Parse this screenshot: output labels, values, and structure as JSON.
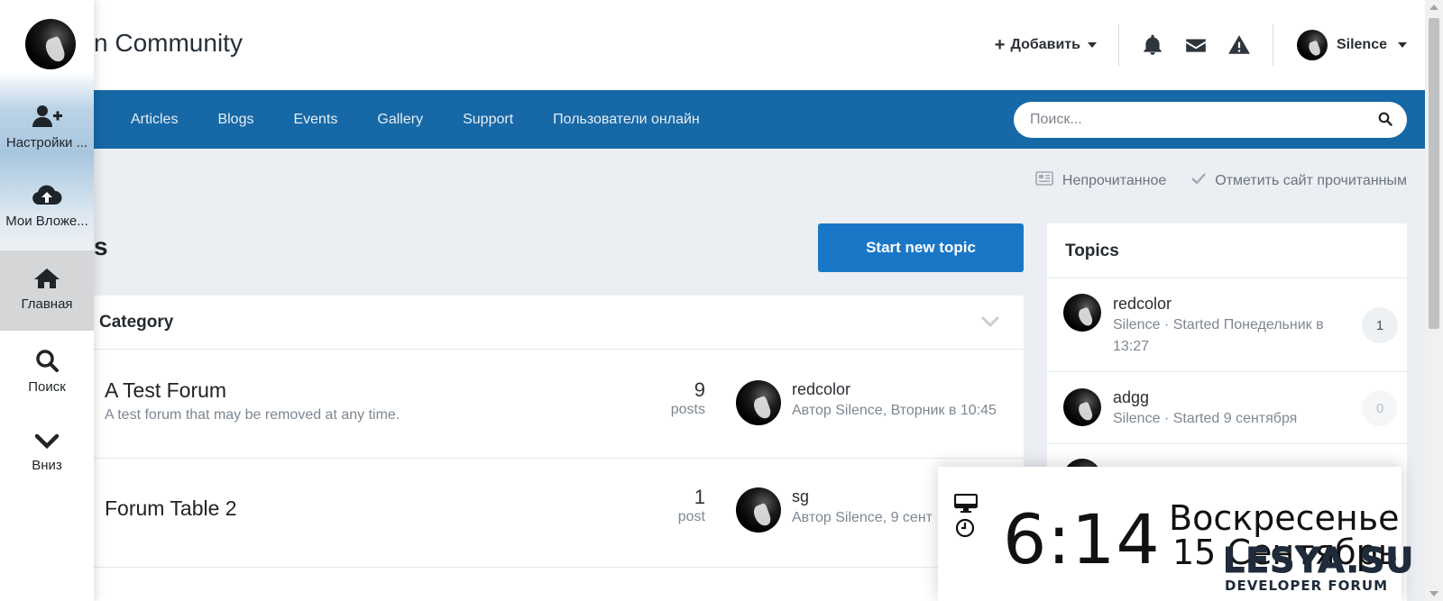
{
  "header": {
    "site_title": "n Community",
    "add_label": "Добавить",
    "user_name": "Silence"
  },
  "nav": {
    "links": [
      "Articles",
      "Blogs",
      "Events",
      "Gallery",
      "Support",
      "Пользователи онлайн"
    ]
  },
  "search": {
    "placeholder": "Поиск..."
  },
  "sub_actions": {
    "unread": "Непрочитанное",
    "mark_read": "Отметить сайт прочитанным"
  },
  "main": {
    "page_title": "s",
    "start_topic": "Start new topic",
    "category": "Category",
    "forums": [
      {
        "name": "A Test Forum",
        "desc": "A test forum that may be removed at any time.",
        "count": "9",
        "count_label": "posts",
        "last_title": "redcolor",
        "last_meta": "Автор Silence, Вторник в 10:45"
      },
      {
        "name": "Forum Table 2",
        "desc": "",
        "count": "1",
        "count_label": "post",
        "last_title": "sg",
        "last_meta": "Автор Silence, 9 сент"
      }
    ]
  },
  "topics": {
    "title": "Topics",
    "items": [
      {
        "title": "redcolor",
        "meta": "Silence · Started Понедельник в 13:27",
        "count": "1"
      },
      {
        "title": "adgg",
        "meta": "Silence · Started 9 сентября",
        "count": "0"
      }
    ]
  },
  "leftpanel": {
    "items": [
      {
        "label": "Настройки ...",
        "icon": "user-plus-icon"
      },
      {
        "label": "Мои Вложе...",
        "icon": "cloud-upload-icon"
      },
      {
        "label": "Главная",
        "icon": "home-icon"
      },
      {
        "label": "Поиск",
        "icon": "search-icon"
      },
      {
        "label": "Вниз",
        "icon": "chevron-down-icon"
      }
    ]
  },
  "clock": {
    "time": "6:14",
    "day": "Воскресенье",
    "date": "15 Сентябрь"
  },
  "watermark": {
    "big": "LESYA.SU",
    "small": "DEVELOPER FORUM"
  },
  "colors": {
    "nav_bg": "#1768a6",
    "accent_button": "#1a77c7",
    "page_bg": "#ebeef2"
  }
}
